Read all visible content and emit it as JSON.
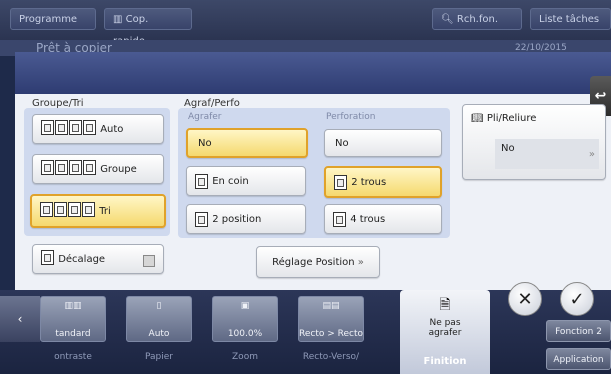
{
  "topbar": {
    "programme": "Programme",
    "copie_rapide": "Cop. rapide",
    "recherche": "Rch.fon.",
    "liste_taches": "Liste tâches",
    "title_partial": "Prêt à copier",
    "date": "22/10/2015"
  },
  "groupe_tri": {
    "title": "Groupe/Tri",
    "auto": "Auto",
    "groupe": "Groupe",
    "tri": "Tri",
    "decalage": "Décalage"
  },
  "agraf_perfo": {
    "title": "Agraf/Perfo",
    "agrafer_label": "Agrafer",
    "agrafer_no": "No",
    "en_coin": "En coin",
    "deux_position": "2 position",
    "perforation_label": "Perforation",
    "perf_no": "No",
    "deux_trous": "2 trous",
    "quatre_trous": "4 trous",
    "reglage": "Réglage Position"
  },
  "pli_reliure": {
    "title": "Pli/Reliure",
    "value": "No"
  },
  "bottom": {
    "tiles": [
      {
        "value": "tandard",
        "caption": "ontraste"
      },
      {
        "value": "Auto",
        "caption": "Papier"
      },
      {
        "value": "100.0%",
        "caption": "Zoom"
      },
      {
        "value": "Recto > Recto",
        "caption": "Recto-Verso/"
      },
      {
        "value": "Ne pas agrafer",
        "caption": "Finition"
      }
    ],
    "side1": "Fonction 2",
    "side2": "Application"
  },
  "actions": {
    "cancel": "✕",
    "ok": "✓"
  }
}
